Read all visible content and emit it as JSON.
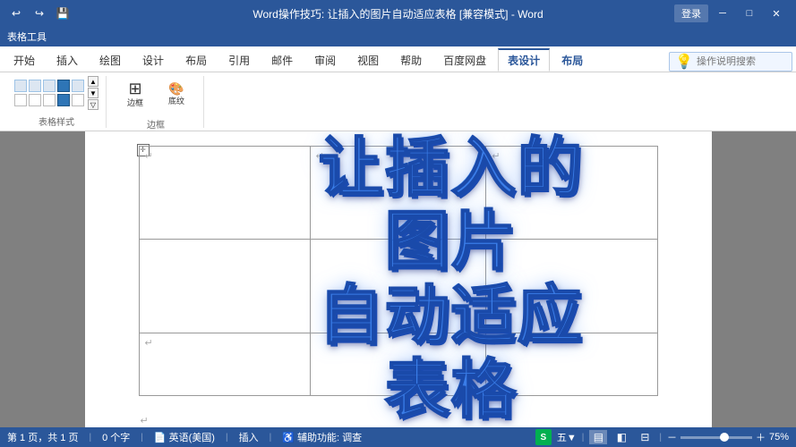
{
  "titlebar": {
    "title": "Word操作技巧: 让插入的图片自动适应表格 [兼容模式] - Word",
    "app_name": "Word",
    "login_label": "登录",
    "undo_icon": "↩",
    "redo_icon": "↪",
    "quick_save_icon": "💾",
    "minimize_icon": "─",
    "restore_icon": "□",
    "close_icon": "✕"
  },
  "table_tools": {
    "label": "表格工具",
    "tabs": [
      "表设计",
      "布局"
    ]
  },
  "ribbon": {
    "tabs": [
      {
        "id": "home",
        "label": "开始",
        "active": false
      },
      {
        "id": "insert",
        "label": "插入",
        "active": false
      },
      {
        "id": "draw",
        "label": "绘图",
        "active": false
      },
      {
        "id": "design",
        "label": "设计",
        "active": false
      },
      {
        "id": "layout",
        "label": "布局",
        "active": false
      },
      {
        "id": "ref",
        "label": "引用",
        "active": false
      },
      {
        "id": "mail",
        "label": "邮件",
        "active": false
      },
      {
        "id": "review",
        "label": "审阅",
        "active": false
      },
      {
        "id": "view",
        "label": "视图",
        "active": false
      },
      {
        "id": "help",
        "label": "帮助",
        "active": false
      },
      {
        "id": "baidu",
        "label": "百度网盘",
        "active": false
      },
      {
        "id": "tabledesign",
        "label": "表设计",
        "active": true
      },
      {
        "id": "tablelayout",
        "label": "布局",
        "active": false
      }
    ],
    "search_placeholder": "操作说明搜索",
    "search_icon": "💡"
  },
  "document": {
    "title_text": "让插入的\n图片\n自动适应\n表格",
    "table": {
      "rows": 3,
      "cols": 3
    }
  },
  "statusbar": {
    "page_info": "第 1 页，共 1 页",
    "char_count": "0 个字",
    "language": "英语(美国)",
    "mode": "插入",
    "accessibility": "辅助功能: 调查",
    "zoom_level": "75%",
    "wps_logo": "S"
  }
}
